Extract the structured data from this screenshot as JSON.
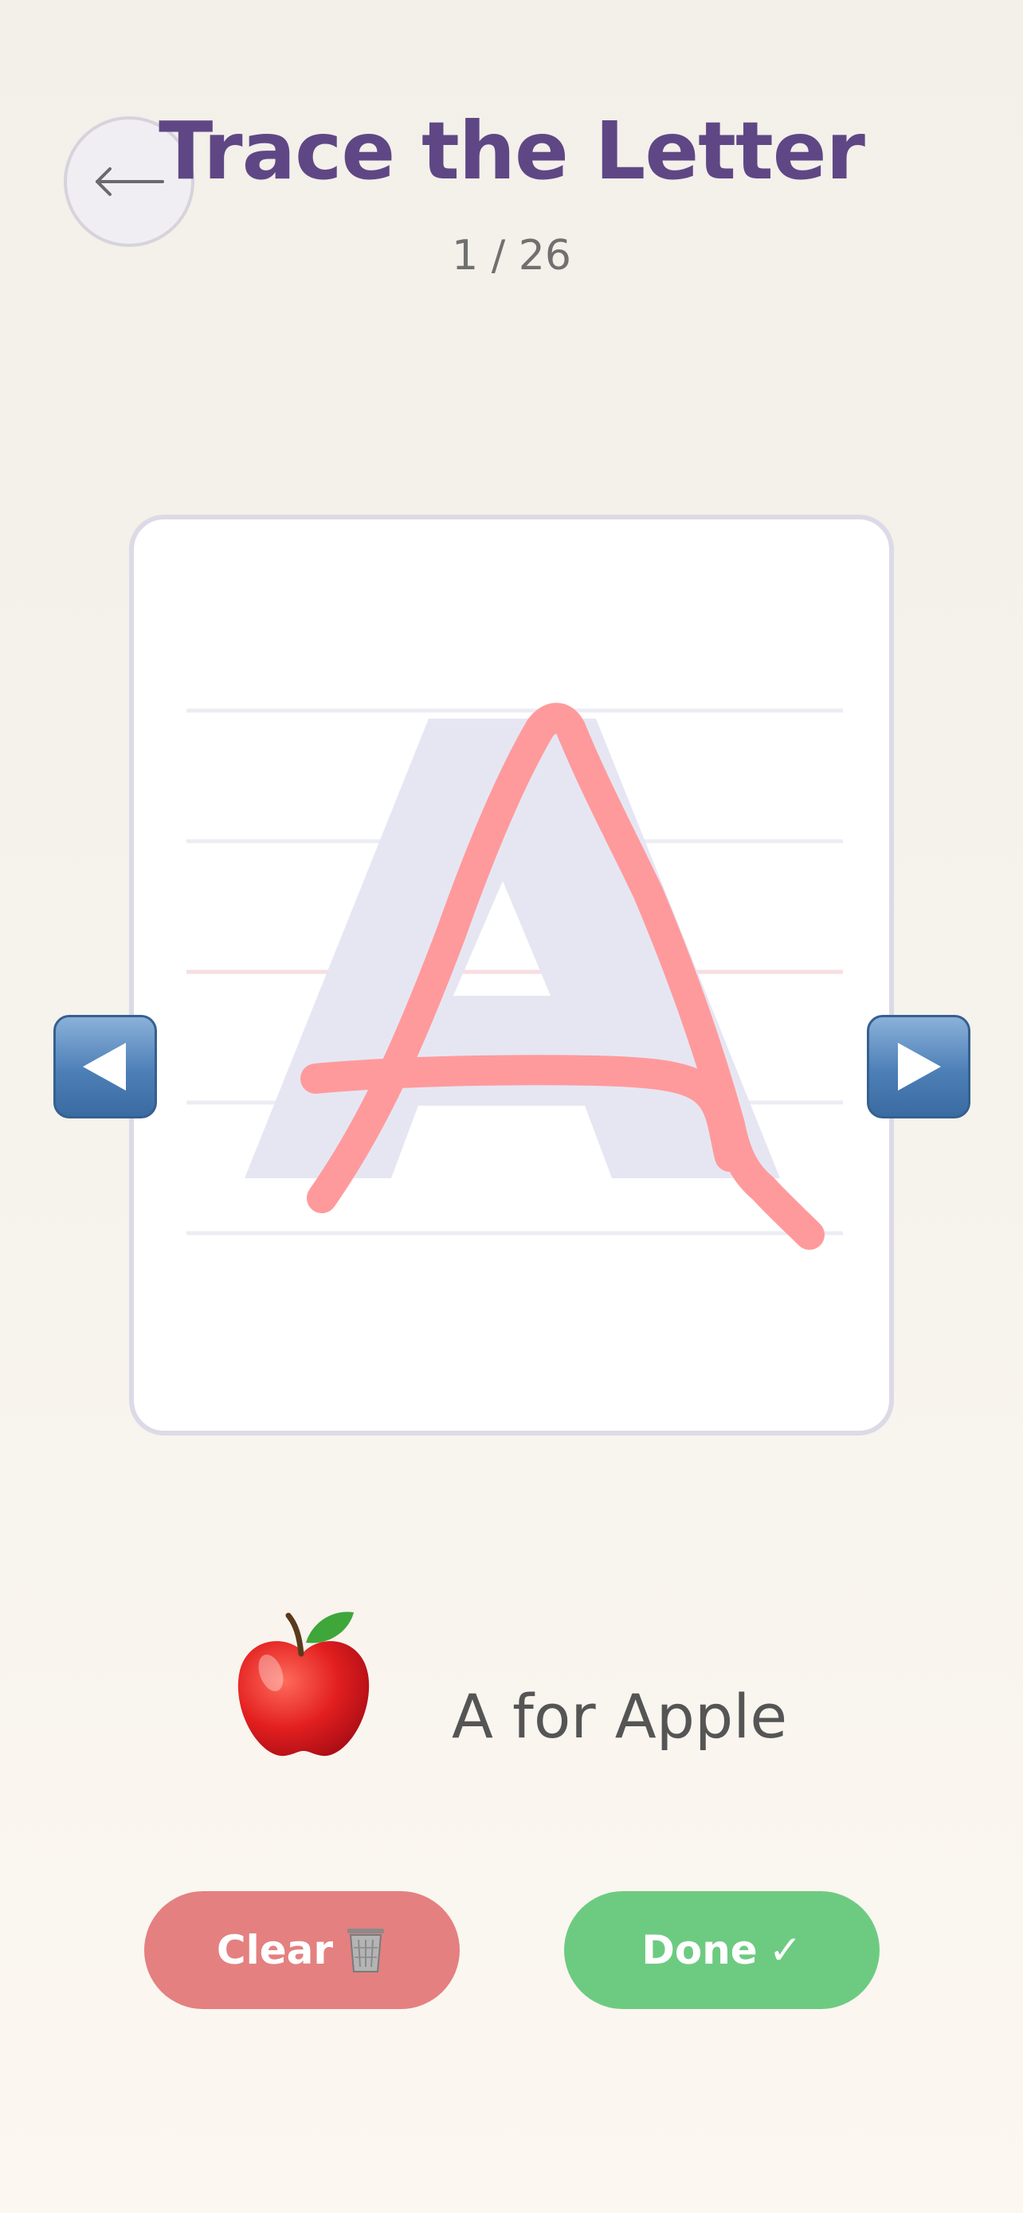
{
  "header": {
    "title": "Trace the Letter",
    "progress": "1 / 26",
    "back_icon": "arrow-left-icon"
  },
  "trace": {
    "letter": "A",
    "guide_color": "#e6e6f3",
    "stroke_color": "#ff9a9c",
    "line_color": "#ececf4",
    "midline_color": "#f7dde2"
  },
  "navigation": {
    "prev_icon": "triangle-left-icon",
    "next_icon": "triangle-right-icon"
  },
  "word": {
    "emoji": "apple-icon",
    "text": "A for Apple"
  },
  "actions": {
    "clear_label": "Clear",
    "clear_icon": "trash-can-icon",
    "done_label": "Done",
    "done_icon": "✓"
  },
  "colors": {
    "title": "#5f4785",
    "clear_button": "#e48080",
    "done_button": "#6dcb81",
    "nav_button": "#4d7fb7"
  }
}
